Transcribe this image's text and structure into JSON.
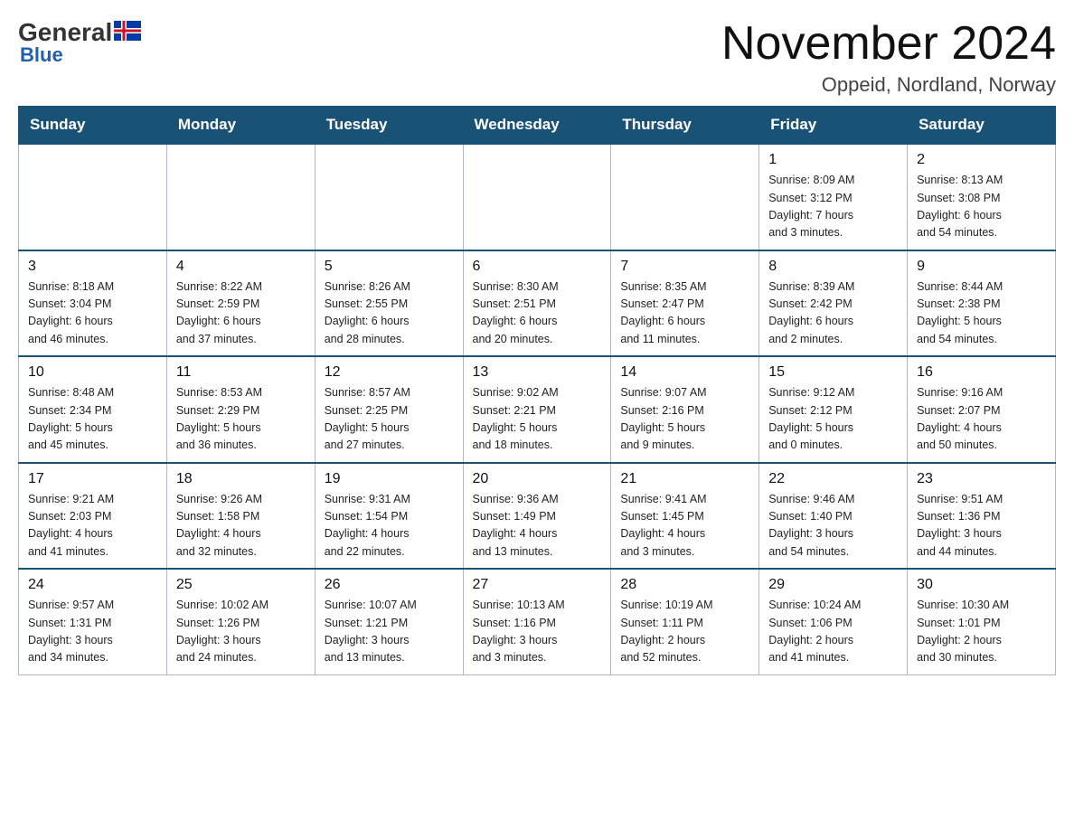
{
  "logo": {
    "general": "General",
    "blue": "Blue"
  },
  "header": {
    "month": "November 2024",
    "location": "Oppeid, Nordland, Norway"
  },
  "weekdays": [
    "Sunday",
    "Monday",
    "Tuesday",
    "Wednesday",
    "Thursday",
    "Friday",
    "Saturday"
  ],
  "weeks": [
    [
      {
        "day": "",
        "info": ""
      },
      {
        "day": "",
        "info": ""
      },
      {
        "day": "",
        "info": ""
      },
      {
        "day": "",
        "info": ""
      },
      {
        "day": "",
        "info": ""
      },
      {
        "day": "1",
        "info": "Sunrise: 8:09 AM\nSunset: 3:12 PM\nDaylight: 7 hours\nand 3 minutes."
      },
      {
        "day": "2",
        "info": "Sunrise: 8:13 AM\nSunset: 3:08 PM\nDaylight: 6 hours\nand 54 minutes."
      }
    ],
    [
      {
        "day": "3",
        "info": "Sunrise: 8:18 AM\nSunset: 3:04 PM\nDaylight: 6 hours\nand 46 minutes."
      },
      {
        "day": "4",
        "info": "Sunrise: 8:22 AM\nSunset: 2:59 PM\nDaylight: 6 hours\nand 37 minutes."
      },
      {
        "day": "5",
        "info": "Sunrise: 8:26 AM\nSunset: 2:55 PM\nDaylight: 6 hours\nand 28 minutes."
      },
      {
        "day": "6",
        "info": "Sunrise: 8:30 AM\nSunset: 2:51 PM\nDaylight: 6 hours\nand 20 minutes."
      },
      {
        "day": "7",
        "info": "Sunrise: 8:35 AM\nSunset: 2:47 PM\nDaylight: 6 hours\nand 11 minutes."
      },
      {
        "day": "8",
        "info": "Sunrise: 8:39 AM\nSunset: 2:42 PM\nDaylight: 6 hours\nand 2 minutes."
      },
      {
        "day": "9",
        "info": "Sunrise: 8:44 AM\nSunset: 2:38 PM\nDaylight: 5 hours\nand 54 minutes."
      }
    ],
    [
      {
        "day": "10",
        "info": "Sunrise: 8:48 AM\nSunset: 2:34 PM\nDaylight: 5 hours\nand 45 minutes."
      },
      {
        "day": "11",
        "info": "Sunrise: 8:53 AM\nSunset: 2:29 PM\nDaylight: 5 hours\nand 36 minutes."
      },
      {
        "day": "12",
        "info": "Sunrise: 8:57 AM\nSunset: 2:25 PM\nDaylight: 5 hours\nand 27 minutes."
      },
      {
        "day": "13",
        "info": "Sunrise: 9:02 AM\nSunset: 2:21 PM\nDaylight: 5 hours\nand 18 minutes."
      },
      {
        "day": "14",
        "info": "Sunrise: 9:07 AM\nSunset: 2:16 PM\nDaylight: 5 hours\nand 9 minutes."
      },
      {
        "day": "15",
        "info": "Sunrise: 9:12 AM\nSunset: 2:12 PM\nDaylight: 5 hours\nand 0 minutes."
      },
      {
        "day": "16",
        "info": "Sunrise: 9:16 AM\nSunset: 2:07 PM\nDaylight: 4 hours\nand 50 minutes."
      }
    ],
    [
      {
        "day": "17",
        "info": "Sunrise: 9:21 AM\nSunset: 2:03 PM\nDaylight: 4 hours\nand 41 minutes."
      },
      {
        "day": "18",
        "info": "Sunrise: 9:26 AM\nSunset: 1:58 PM\nDaylight: 4 hours\nand 32 minutes."
      },
      {
        "day": "19",
        "info": "Sunrise: 9:31 AM\nSunset: 1:54 PM\nDaylight: 4 hours\nand 22 minutes."
      },
      {
        "day": "20",
        "info": "Sunrise: 9:36 AM\nSunset: 1:49 PM\nDaylight: 4 hours\nand 13 minutes."
      },
      {
        "day": "21",
        "info": "Sunrise: 9:41 AM\nSunset: 1:45 PM\nDaylight: 4 hours\nand 3 minutes."
      },
      {
        "day": "22",
        "info": "Sunrise: 9:46 AM\nSunset: 1:40 PM\nDaylight: 3 hours\nand 54 minutes."
      },
      {
        "day": "23",
        "info": "Sunrise: 9:51 AM\nSunset: 1:36 PM\nDaylight: 3 hours\nand 44 minutes."
      }
    ],
    [
      {
        "day": "24",
        "info": "Sunrise: 9:57 AM\nSunset: 1:31 PM\nDaylight: 3 hours\nand 34 minutes."
      },
      {
        "day": "25",
        "info": "Sunrise: 10:02 AM\nSunset: 1:26 PM\nDaylight: 3 hours\nand 24 minutes."
      },
      {
        "day": "26",
        "info": "Sunrise: 10:07 AM\nSunset: 1:21 PM\nDaylight: 3 hours\nand 13 minutes."
      },
      {
        "day": "27",
        "info": "Sunrise: 10:13 AM\nSunset: 1:16 PM\nDaylight: 3 hours\nand 3 minutes."
      },
      {
        "day": "28",
        "info": "Sunrise: 10:19 AM\nSunset: 1:11 PM\nDaylight: 2 hours\nand 52 minutes."
      },
      {
        "day": "29",
        "info": "Sunrise: 10:24 AM\nSunset: 1:06 PM\nDaylight: 2 hours\nand 41 minutes."
      },
      {
        "day": "30",
        "info": "Sunrise: 10:30 AM\nSunset: 1:01 PM\nDaylight: 2 hours\nand 30 minutes."
      }
    ]
  ]
}
